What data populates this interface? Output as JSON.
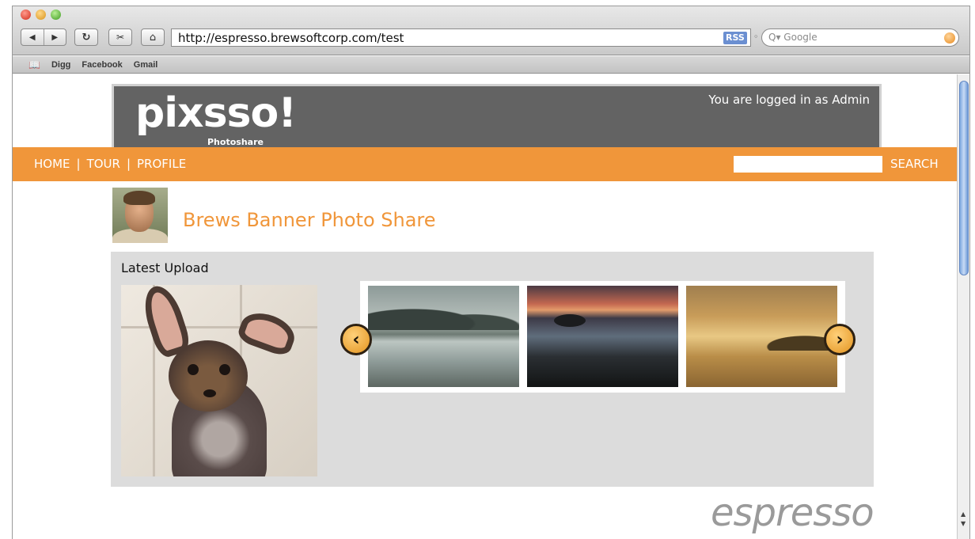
{
  "browser": {
    "url": "http://espresso.brewsoftcorp.com/test",
    "rss_badge": "RSS",
    "search_placeholder": "Google",
    "bookmarks": [
      "Digg",
      "Facebook",
      "Gmail"
    ]
  },
  "site": {
    "logo": "pixsso!",
    "logo_sub": "Photoshare",
    "login_status": "You are logged in as Admin",
    "nav": [
      {
        "label": "HOME"
      },
      {
        "label": "TOUR"
      },
      {
        "label": "PROFILE"
      }
    ],
    "nav_separator": "|",
    "search_button": "SEARCH",
    "page_title": "Brews Banner Photo Share",
    "latest_upload_label": "Latest Upload",
    "carousel_prev_icon": "chevron-left-icon",
    "carousel_next_icon": "chevron-right-icon",
    "brand_text": "espresso"
  },
  "colors": {
    "accent": "#f0963a",
    "header_bg": "#636363",
    "gallery_bg": "#dcdcdc"
  }
}
